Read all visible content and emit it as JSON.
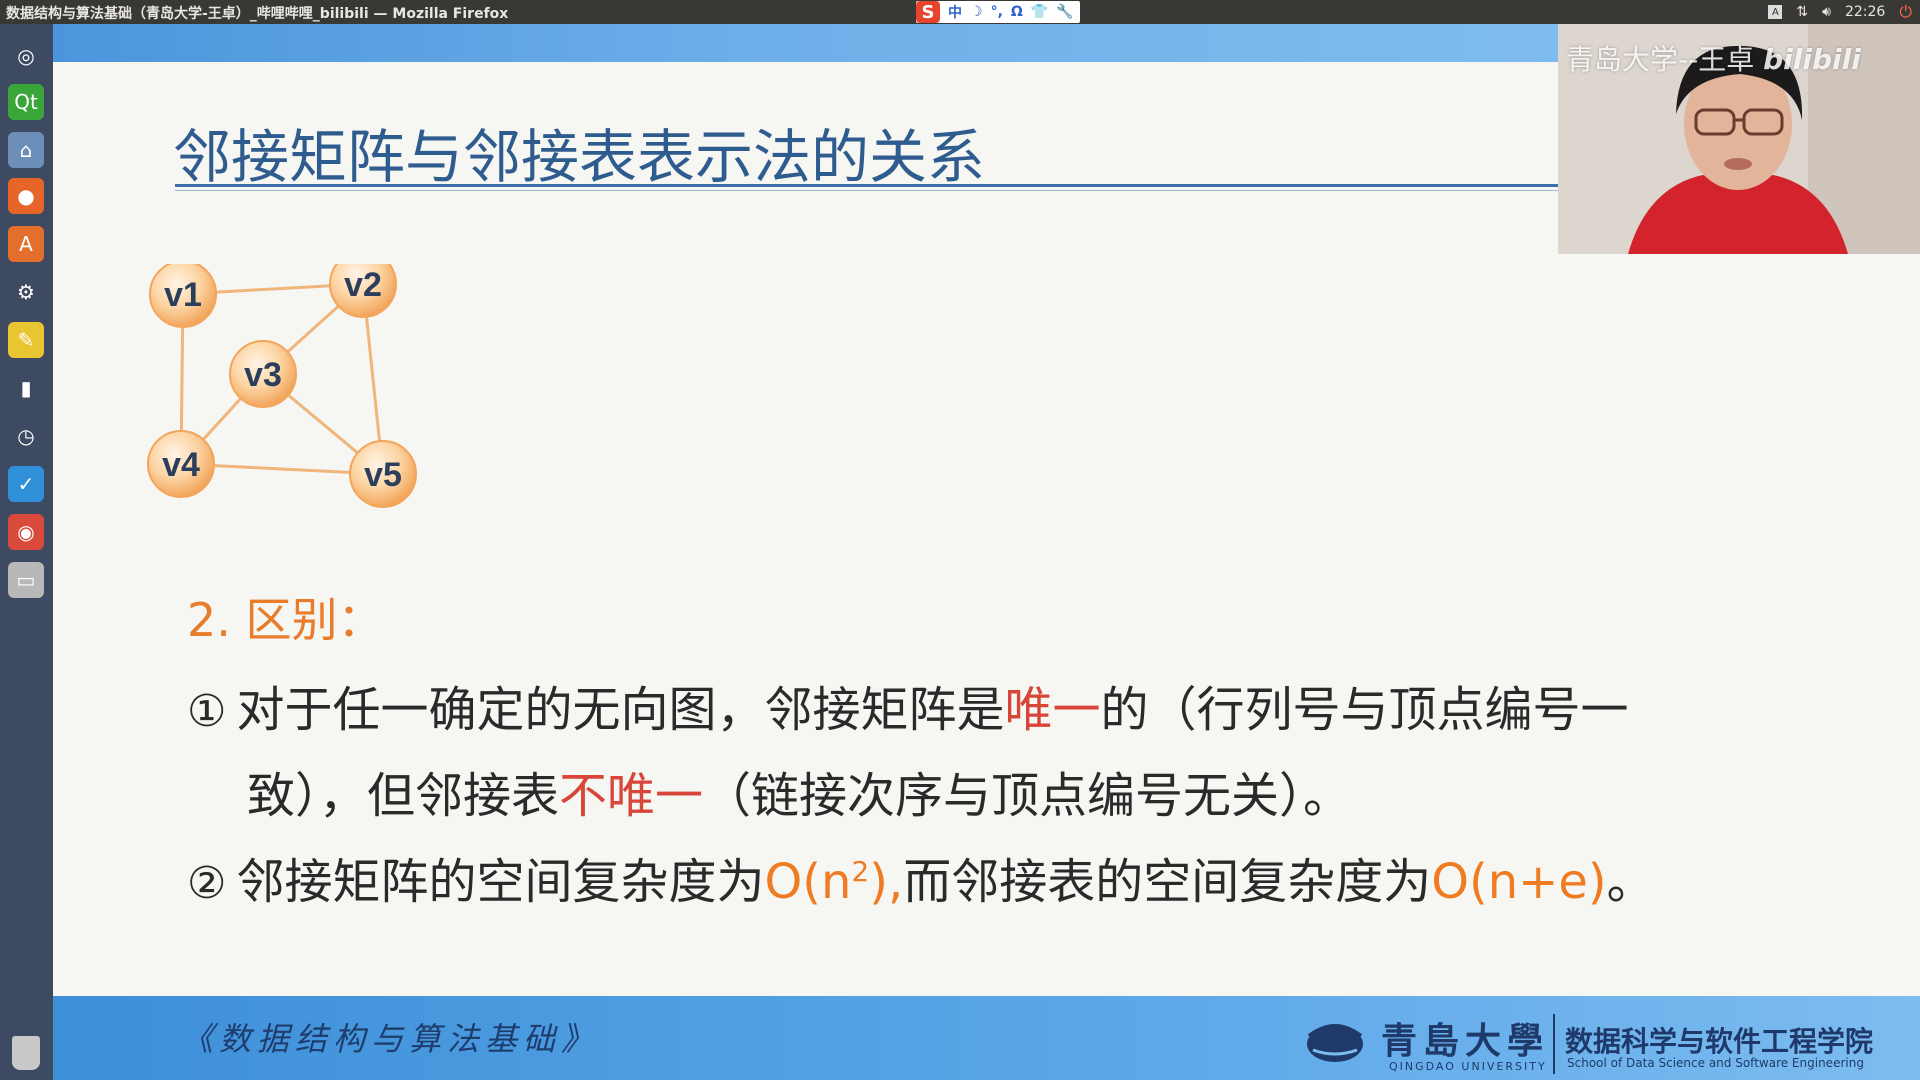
{
  "window": {
    "title": "数据结构与算法基础（青岛大学-王卓）_哔哩哔哩_bilibili — Mozilla Firefox"
  },
  "ime": {
    "logo": "S",
    "items": [
      "中",
      "☽",
      "°,",
      "Ω",
      "👕",
      "🔧"
    ]
  },
  "tray": {
    "keyboard": "A",
    "network_icon": "network-updown-icon",
    "volume_icon": "volume-icon",
    "time": "22:26",
    "power_icon": "power-icon"
  },
  "launcher": {
    "items": [
      {
        "name": "ubuntu-dash",
        "glyph": "◎",
        "color": "#3d4a61"
      },
      {
        "name": "qt-creator",
        "glyph": "Qt",
        "color": "#3aa63a"
      },
      {
        "name": "files",
        "glyph": "⌂",
        "color": "#6b8fb8"
      },
      {
        "name": "firefox",
        "glyph": "●",
        "color": "#e8652a"
      },
      {
        "name": "software-center",
        "glyph": "A",
        "color": "#e46e2c"
      },
      {
        "name": "settings",
        "glyph": "⚙",
        "color": "#3d4a61"
      },
      {
        "name": "notes",
        "glyph": "✎",
        "color": "#e9c531"
      },
      {
        "name": "monitor",
        "glyph": "▮",
        "color": "#3d4a61"
      },
      {
        "name": "clock",
        "glyph": "◷",
        "color": "#3d4a61"
      },
      {
        "name": "editor",
        "glyph": "✓",
        "color": "#2f8fd8"
      },
      {
        "name": "chrome",
        "glyph": "◉",
        "color": "#d94a3a"
      },
      {
        "name": "drive",
        "glyph": "▭",
        "color": "#b8b8b8"
      }
    ]
  },
  "slide": {
    "title": "邻接矩阵与邻接表表示法的关系",
    "graph": {
      "nodes": [
        {
          "id": "v1",
          "label": "v1"
        },
        {
          "id": "v2",
          "label": "v2"
        },
        {
          "id": "v3",
          "label": "v3"
        },
        {
          "id": "v4",
          "label": "v4"
        },
        {
          "id": "v5",
          "label": "v5"
        }
      ],
      "edges": [
        [
          "v1",
          "v2"
        ],
        [
          "v1",
          "v4"
        ],
        [
          "v2",
          "v3"
        ],
        [
          "v2",
          "v5"
        ],
        [
          "v3",
          "v4"
        ],
        [
          "v3",
          "v5"
        ],
        [
          "v4",
          "v5"
        ]
      ]
    },
    "section_heading": "2. 区别：",
    "item1": {
      "marker": "①",
      "part_a": "对于任一确定的无向图，邻接矩阵是",
      "highlight_a": "唯一",
      "part_b": "的（行列号与顶点编号一",
      "line2_a": "致），但邻接表",
      "highlight_b": "不唯一",
      "line2_b": "（链接次序与顶点编号无关）。"
    },
    "item2": {
      "marker": "②",
      "part_a": "邻接矩阵的空间复杂度为",
      "complexity_a_base": "O(n",
      "complexity_a_exp": "2",
      "complexity_a_tail": "),",
      "part_b": "而邻接表的空间复杂度为",
      "complexity_b": "O(n+e)",
      "end": "。"
    },
    "footer": {
      "course": "《数据结构与算法基础》",
      "university": "青島大學",
      "university_en": "QINGDAO UNIVERSITY",
      "school": "数据科学与软件工程学院",
      "school_en": "School of Data Science and Software Engineering"
    }
  },
  "webcam": {
    "watermark": "青岛大学--王卓",
    "brand": "bilibili"
  }
}
